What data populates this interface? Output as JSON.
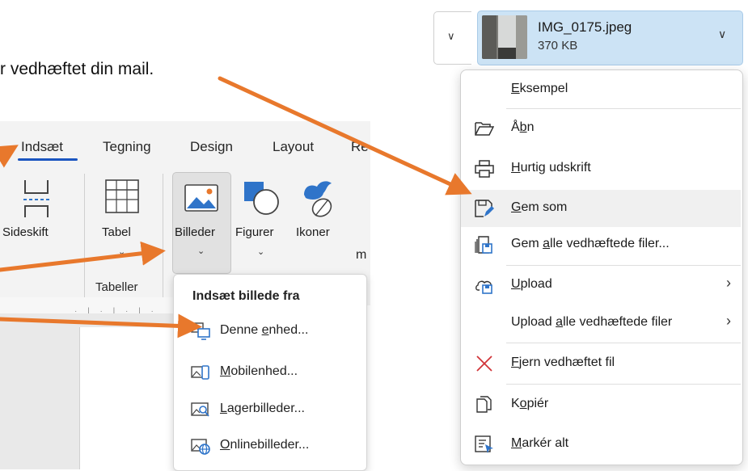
{
  "intro": {
    "text": "r vedhæftet din mail."
  },
  "ribbon": {
    "tabs": [
      {
        "label": "Indsæt",
        "active": true
      },
      {
        "label": "Tegning"
      },
      {
        "label": "Design"
      },
      {
        "label": "Layout"
      },
      {
        "label": "Re"
      }
    ],
    "buttons": {
      "sideskift": "Sideskift",
      "tabel": "Tabel",
      "billeder": "Billeder",
      "figurer": "Figurer",
      "ikoner": "Ikoner",
      "more": "m"
    },
    "group_label": "Tabeller"
  },
  "insert_picture_menu": {
    "title": "Indsæt billede fra",
    "items": [
      {
        "label": "Denne enhed...",
        "icon": "this-device-icon"
      },
      {
        "label": "Mobilenhed...",
        "icon": "mobile-device-icon"
      },
      {
        "label": "Lagerbilleder...",
        "icon": "stock-images-icon"
      },
      {
        "label": "Onlinebilleder...",
        "icon": "online-pictures-icon"
      }
    ]
  },
  "attachment": {
    "filename": "IMG_0175.jpeg",
    "size": "370 KB"
  },
  "context_menu": {
    "items": [
      {
        "label": "Eksempel",
        "icon": ""
      },
      {
        "label": "Åbn",
        "icon": "folder-open-icon"
      },
      {
        "label": "Hurtig udskrift",
        "icon": "printer-icon"
      },
      {
        "label": "Gem som",
        "icon": "save-as-icon"
      },
      {
        "label": "Gem alle vedhæftede filer...",
        "icon": "save-all-icon"
      },
      {
        "label": "Upload",
        "icon": "upload-icon"
      },
      {
        "label": "Upload alle vedhæftede filer",
        "icon": ""
      },
      {
        "label": "Fjern vedhæftet fil",
        "icon": "remove-icon"
      },
      {
        "label": "Kopiér",
        "icon": "copy-icon"
      },
      {
        "label": "Markér alt",
        "icon": "select-all-icon"
      }
    ]
  },
  "colors": {
    "accent_blue": "#1a55c0",
    "arrow_orange": "#e8782c",
    "chip_bg": "#cce3f5",
    "remove_red": "#d13438"
  }
}
